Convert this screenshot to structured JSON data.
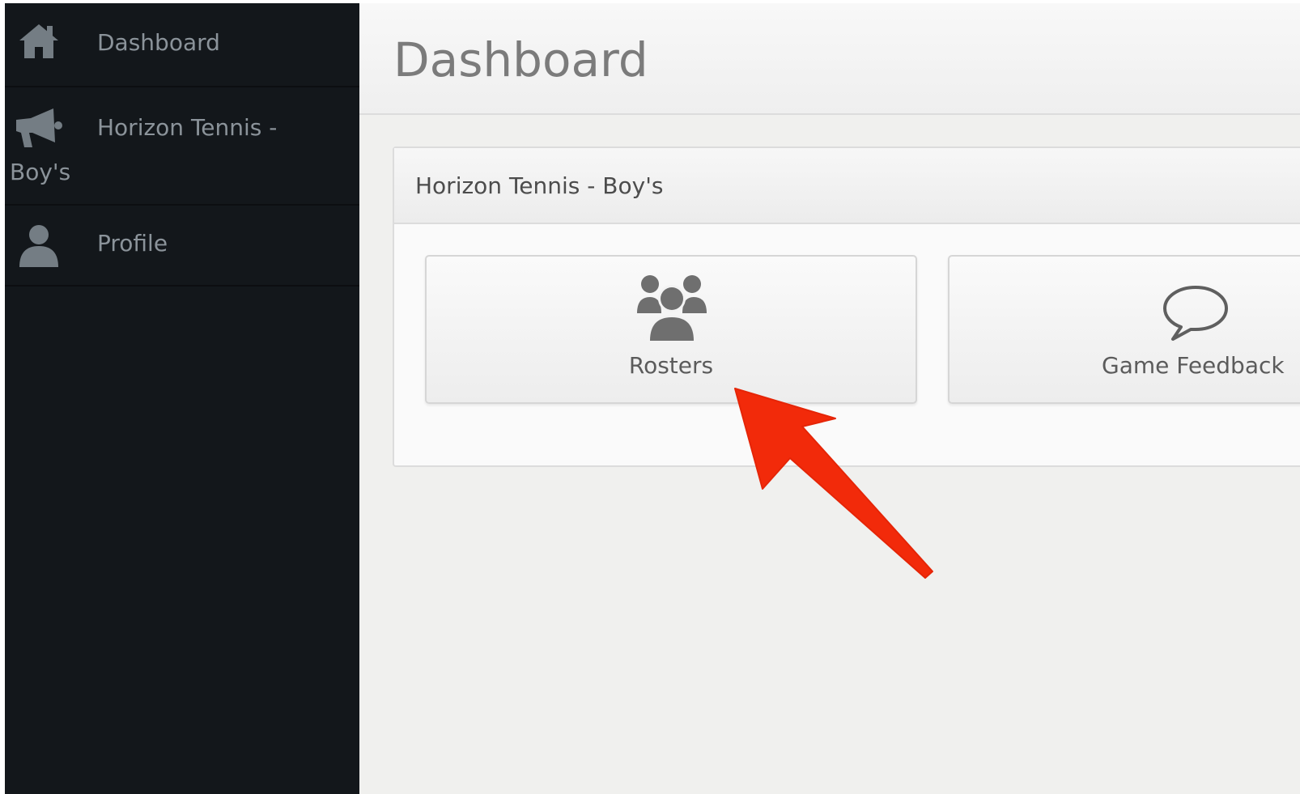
{
  "sidebar": {
    "items": [
      {
        "label": "Dashboard",
        "icon": "home-icon"
      },
      {
        "label_line1": "Horizon Tennis -",
        "label_line2": "Boy's",
        "icon": "megaphone-icon"
      },
      {
        "label": "Profile",
        "icon": "user-icon"
      }
    ]
  },
  "header": {
    "title": "Dashboard"
  },
  "panel": {
    "title": "Horizon Tennis - Boy's",
    "tiles": [
      {
        "label": "Rosters",
        "icon": "users-group-icon"
      },
      {
        "label": "Game Feedback",
        "icon": "speech-bubble-icon"
      }
    ]
  },
  "colors": {
    "sidebar_bg": "#13171b",
    "annotation_arrow": "#f22a0a"
  }
}
